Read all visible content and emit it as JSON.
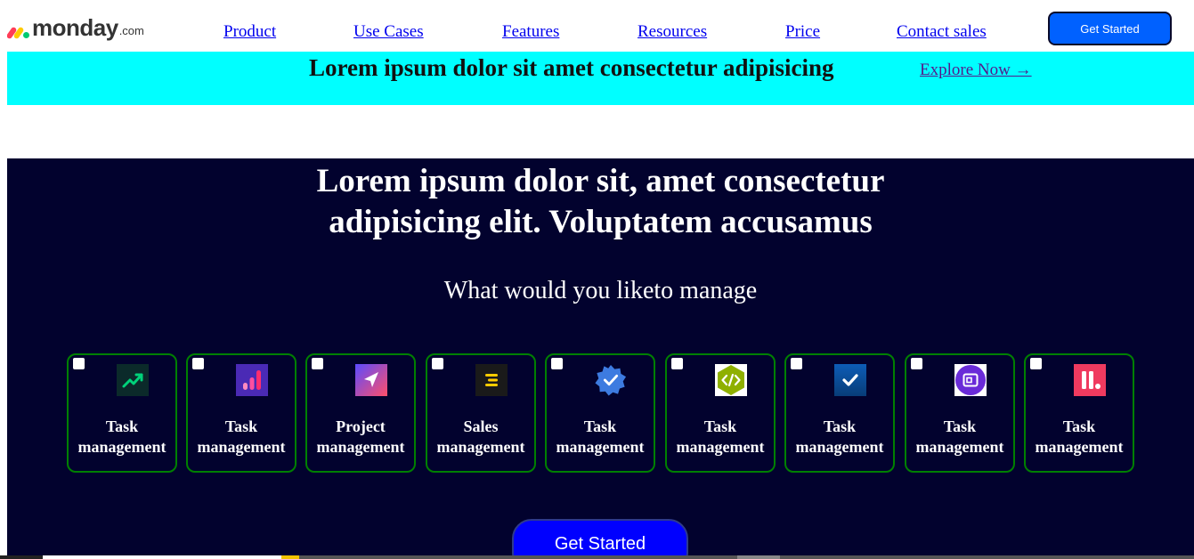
{
  "brand": {
    "name": "monday",
    "suffix": ".com"
  },
  "nav": {
    "links": [
      "Product",
      "Use Cases",
      "Features",
      "Resources",
      "Price",
      "Contact sales"
    ],
    "cta": "Get Started"
  },
  "banner": {
    "headline": "Lorem ipsum dolor sit amet consectetur adipisicing",
    "link": "Explore Now →"
  },
  "hero": {
    "title_line1": "Lorem ipsum dolor sit, amet consectetur",
    "title_line2": "adipisicing elit. Voluptatem accusamus",
    "subtitle": "What would you liketo manage",
    "cta": "Get Started"
  },
  "options": [
    {
      "line1": "Task",
      "line2": "management",
      "icon": "trending-up-icon",
      "icon_bg": "#0b2a2a",
      "icon_fg": "#00d27a",
      "checked": false
    },
    {
      "line1": "Task",
      "line2": "management",
      "icon": "bar-chart-icon",
      "icon_bg": "#4a2ab5",
      "icon_fg": "#ff4fa0",
      "checked": false
    },
    {
      "line1": "Project",
      "line2": "management",
      "icon": "paper-plane-icon",
      "icon_bg": "#7a3cf0",
      "icon_fg": "#ffffff",
      "checked": false
    },
    {
      "line1": "Sales",
      "line2": "management",
      "icon": "menu-lines-icon",
      "icon_bg": "#1a1a1a",
      "icon_fg": "#ffcc00",
      "checked": false
    },
    {
      "line1": "Task",
      "line2": "management",
      "icon": "verified-badge-icon",
      "icon_bg": "#02022e",
      "icon_fg": "#3d7be0",
      "checked": false
    },
    {
      "line1": "Task",
      "line2": "management",
      "icon": "code-icon",
      "icon_bg": "#8fb000",
      "icon_fg": "#ffffff",
      "checked": false
    },
    {
      "line1": "Task",
      "line2": "management",
      "icon": "checkmark-icon",
      "icon_bg": "#0a4a9a",
      "icon_fg": "#ffffff",
      "checked": false
    },
    {
      "line1": "Task",
      "line2": "management",
      "icon": "picture-frame-icon",
      "icon_bg": "#ffffff",
      "icon_fg": "#6a2bd8",
      "checked": false
    },
    {
      "line1": "Task",
      "line2": "management",
      "icon": "pause-dot-icon",
      "icon_bg": "#f03a5f",
      "icon_fg": "#ffffff",
      "checked": false
    }
  ],
  "colors": {
    "banner_bg": "#00ffff",
    "hero_bg": "#02022e",
    "card_border": "#008000",
    "cta_blue": "#0061ff",
    "main_button": "#0000ff"
  }
}
